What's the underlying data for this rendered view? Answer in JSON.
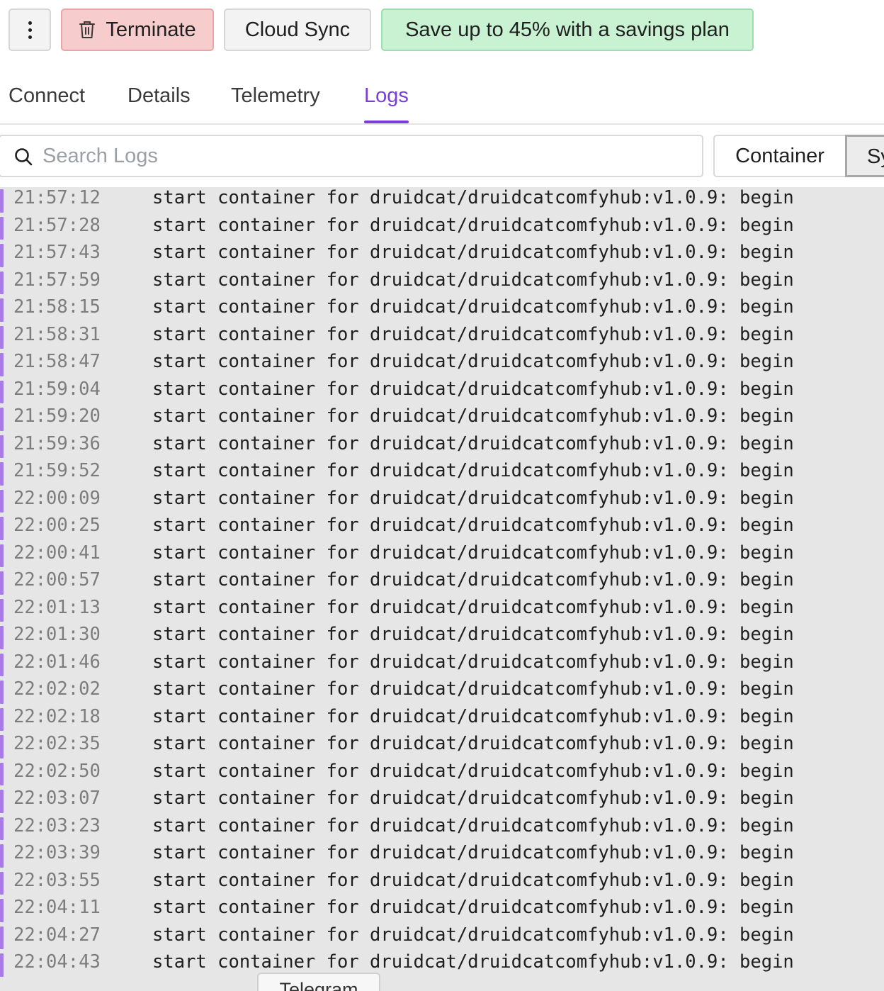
{
  "toolbar": {
    "more_icon": "vertical-dots-icon",
    "terminate_label": "Terminate",
    "terminate_icon": "trash-icon",
    "cloud_sync_label": "Cloud Sync",
    "savings_label": "Save up to 45% with a savings plan",
    "colors": {
      "terminate_bg": "#f6cccc",
      "savings_bg": "#c9f2d2"
    }
  },
  "tabs": [
    {
      "label": "Connect",
      "active": false
    },
    {
      "label": "Details",
      "active": false
    },
    {
      "label": "Telemetry",
      "active": false
    },
    {
      "label": "Logs",
      "active": true
    }
  ],
  "accent_color": "#7a3fd6",
  "search": {
    "placeholder": "Search Logs",
    "value": "",
    "icon": "search-icon"
  },
  "filters": {
    "container_label": "Container",
    "system_label": "Sy"
  },
  "logs": [
    {
      "time": "21:57:12",
      "message": "start container for druidcat/druidcatcomfyhub:v1.0.9: begin"
    },
    {
      "time": "21:57:28",
      "message": "start container for druidcat/druidcatcomfyhub:v1.0.9: begin"
    },
    {
      "time": "21:57:43",
      "message": "start container for druidcat/druidcatcomfyhub:v1.0.9: begin"
    },
    {
      "time": "21:57:59",
      "message": "start container for druidcat/druidcatcomfyhub:v1.0.9: begin"
    },
    {
      "time": "21:58:15",
      "message": "start container for druidcat/druidcatcomfyhub:v1.0.9: begin"
    },
    {
      "time": "21:58:31",
      "message": "start container for druidcat/druidcatcomfyhub:v1.0.9: begin"
    },
    {
      "time": "21:58:47",
      "message": "start container for druidcat/druidcatcomfyhub:v1.0.9: begin"
    },
    {
      "time": "21:59:04",
      "message": "start container for druidcat/druidcatcomfyhub:v1.0.9: begin"
    },
    {
      "time": "21:59:20",
      "message": "start container for druidcat/druidcatcomfyhub:v1.0.9: begin"
    },
    {
      "time": "21:59:36",
      "message": "start container for druidcat/druidcatcomfyhub:v1.0.9: begin"
    },
    {
      "time": "21:59:52",
      "message": "start container for druidcat/druidcatcomfyhub:v1.0.9: begin"
    },
    {
      "time": "22:00:09",
      "message": "start container for druidcat/druidcatcomfyhub:v1.0.9: begin"
    },
    {
      "time": "22:00:25",
      "message": "start container for druidcat/druidcatcomfyhub:v1.0.9: begin"
    },
    {
      "time": "22:00:41",
      "message": "start container for druidcat/druidcatcomfyhub:v1.0.9: begin"
    },
    {
      "time": "22:00:57",
      "message": "start container for druidcat/druidcatcomfyhub:v1.0.9: begin"
    },
    {
      "time": "22:01:13",
      "message": "start container for druidcat/druidcatcomfyhub:v1.0.9: begin"
    },
    {
      "time": "22:01:30",
      "message": "start container for druidcat/druidcatcomfyhub:v1.0.9: begin"
    },
    {
      "time": "22:01:46",
      "message": "start container for druidcat/druidcatcomfyhub:v1.0.9: begin"
    },
    {
      "time": "22:02:02",
      "message": "start container for druidcat/druidcatcomfyhub:v1.0.9: begin"
    },
    {
      "time": "22:02:18",
      "message": "start container for druidcat/druidcatcomfyhub:v1.0.9: begin"
    },
    {
      "time": "22:02:35",
      "message": "start container for druidcat/druidcatcomfyhub:v1.0.9: begin"
    },
    {
      "time": "22:02:50",
      "message": "start container for druidcat/druidcatcomfyhub:v1.0.9: begin"
    },
    {
      "time": "22:03:07",
      "message": "start container for druidcat/druidcatcomfyhub:v1.0.9: begin"
    },
    {
      "time": "22:03:23",
      "message": "start container for druidcat/druidcatcomfyhub:v1.0.9: begin"
    },
    {
      "time": "22:03:39",
      "message": "start container for druidcat/druidcatcomfyhub:v1.0.9: begin"
    },
    {
      "time": "22:03:55",
      "message": "start container for druidcat/druidcatcomfyhub:v1.0.9: begin"
    },
    {
      "time": "22:04:11",
      "message": "start container for druidcat/druidcatcomfyhub:v1.0.9: begin"
    },
    {
      "time": "22:04:27",
      "message": "start container for druidcat/druidcatcomfyhub:v1.0.9: begin"
    },
    {
      "time": "22:04:43",
      "message": "start container for druidcat/druidcatcomfyhub:v1.0.9: begin"
    }
  ],
  "floating_tab": {
    "label": "Telegram"
  }
}
